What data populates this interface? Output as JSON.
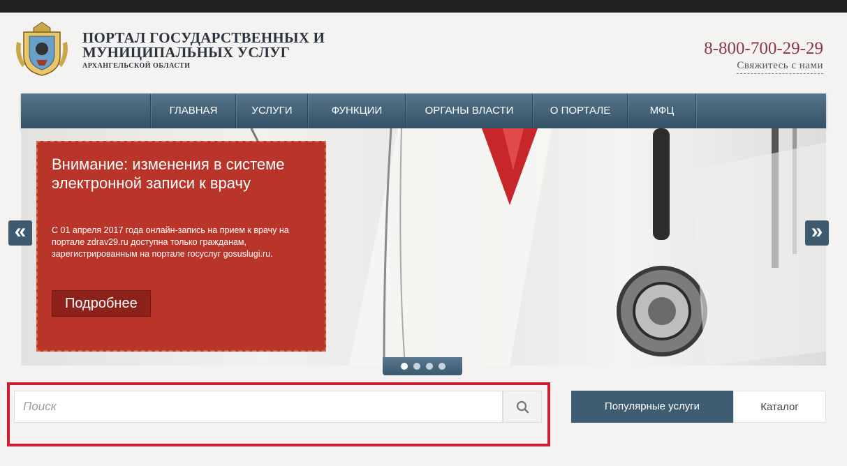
{
  "header": {
    "title_line1": "ПОРТАЛ ГОСУДАРСТВЕННЫХ И",
    "title_line2": "МУНИЦИПАЛЬНЫХ УСЛУГ",
    "title_line3": "АРХАНГЕЛЬСКОЙ ОБЛАСТИ",
    "phone": "8-800-700-29-29",
    "contact_link": "Свяжитесь с нами"
  },
  "nav": {
    "items": [
      {
        "label": "ГЛАВНАЯ"
      },
      {
        "label": "УСЛУГИ"
      },
      {
        "label": "ФУНКЦИИ"
      },
      {
        "label": "ОРГАНЫ ВЛАСТИ"
      },
      {
        "label": "О ПОРТАЛЕ"
      },
      {
        "label": "МФЦ"
      }
    ]
  },
  "slider": {
    "title": "Внимание: изменения в системе электронной записи к врачу",
    "text": "С 01 апреля 2017 года онлайн-запись на прием к врачу на портале zdrav29.ru доступна только гражданам, зарегистрированным на портале госуслуг gosuslugi.ru.",
    "more_label": "Подробнее",
    "prev_label": "«",
    "next_label": "»",
    "dots_count": 4,
    "active_dot": 1
  },
  "search": {
    "placeholder": "Поиск",
    "icon": "search-icon"
  },
  "tabs": {
    "popular": "Популярные услуги",
    "catalog": "Каталог"
  },
  "colors": {
    "nav_bg": "#3e5d72",
    "banner_bg": "#b9352a",
    "highlight_frame": "#cd1f30",
    "phone": "#8a3a44"
  }
}
